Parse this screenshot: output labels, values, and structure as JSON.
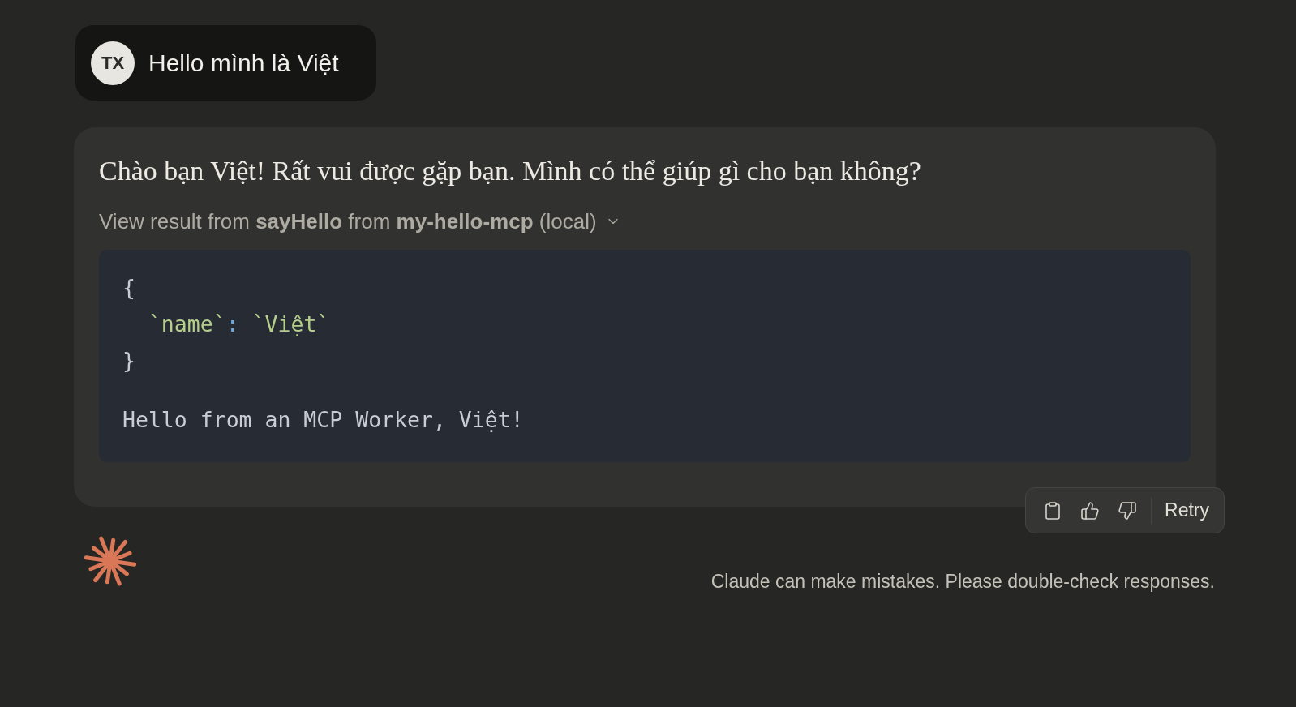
{
  "user_message": {
    "avatar": "TX",
    "text": "Hello mình là Việt"
  },
  "assistant_message": {
    "text": "Chào bạn Việt! Rất vui được gặp bạn. Mình có thể giúp gì cho bạn không?",
    "tool_result": {
      "label": "View result from **sayHello** from **my-hello-mcp** (local)",
      "expanded": true,
      "json_lines": [
        {
          "tokens": [
            {
              "kind": "plain",
              "text": "{"
            }
          ]
        },
        {
          "tokens": [
            {
              "kind": "string",
              "text": "  `name`"
            },
            {
              "kind": "colon",
              "text": ":"
            },
            {
              "kind": "string",
              "text": " `Việt`"
            }
          ]
        },
        {
          "tokens": [
            {
              "kind": "plain",
              "text": "}"
            }
          ]
        }
      ],
      "output": "Hello from an MCP Worker, Việt!"
    }
  },
  "actions": {
    "retry": "Retry"
  },
  "disclaimer": "Claude can make mistakes. Please double-check responses."
}
